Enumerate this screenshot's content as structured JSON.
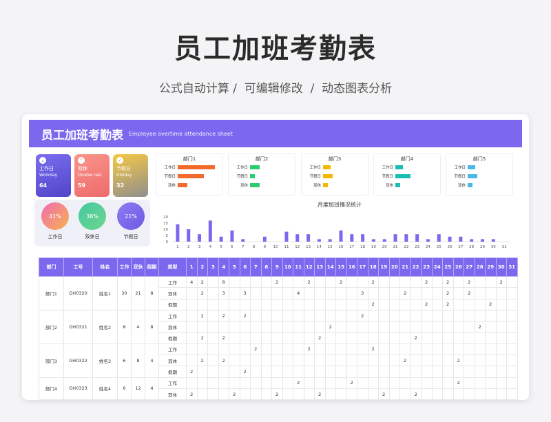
{
  "header": {
    "title": "员工加班考勤表",
    "subtitle": "公式自动计算 /  可编辑修改  /  动态图表分析"
  },
  "sheet": {
    "title": "员工加班考勤表",
    "title_en": "Employee overtime attendance sheet"
  },
  "cards": [
    {
      "label_cn": "工作日",
      "label_en": "Workday",
      "value": "64",
      "icon": "chevron-down-icon",
      "color": "#6a5be0"
    },
    {
      "label_cn": "双休",
      "label_en": "Double rest",
      "value": "59",
      "icon": "chevron-up-icon",
      "color": "#f47a6e"
    },
    {
      "label_cn": "节假日",
      "label_en": "Holiday",
      "value": "32",
      "icon": "check-icon",
      "color": "#f0b428"
    }
  ],
  "rings": [
    {
      "label": "工作日",
      "pct": "41%"
    },
    {
      "label": "双休日",
      "pct": "38%"
    },
    {
      "label": "节假日",
      "pct": "21%"
    }
  ],
  "dept_labels": [
    "工作日",
    "节假日",
    "双休"
  ],
  "dept_charts": [
    {
      "name": "部门1",
      "color": "#f26a2c",
      "values": [
        30,
        21,
        8
      ]
    },
    {
      "name": "部门2",
      "color": "#2ecc71",
      "values": [
        8,
        4,
        8
      ]
    },
    {
      "name": "部门3",
      "color": "#f5b800",
      "values": [
        6,
        8,
        4
      ]
    },
    {
      "name": "部门4",
      "color": "#18bfb0",
      "values": [
        6,
        12,
        4
      ]
    },
    {
      "name": "部门5",
      "color": "#4cb8e8",
      "values": [
        6,
        8,
        4
      ]
    }
  ],
  "chart_data": {
    "type": "bar",
    "title": "月度加班情况统计",
    "categories": [
      "1",
      "2",
      "3",
      "4",
      "5",
      "6",
      "7",
      "8",
      "9",
      "10",
      "11",
      "12",
      "13",
      "14",
      "15",
      "16",
      "17",
      "18",
      "19",
      "20",
      "21",
      "22",
      "23",
      "24",
      "25",
      "26",
      "27",
      "28",
      "29",
      "30",
      "31"
    ],
    "values": [
      14,
      10,
      6,
      17,
      4,
      9,
      2,
      0,
      4,
      0,
      8,
      6,
      6,
      2,
      2,
      9,
      6,
      6,
      2,
      2,
      6,
      6,
      6,
      2,
      6,
      4,
      4,
      2,
      2,
      2,
      0
    ],
    "yticks": [
      "0",
      "5",
      "10",
      "15",
      "20"
    ],
    "ylim": [
      0,
      20
    ],
    "color": "#7b68ee"
  },
  "table": {
    "headers": [
      "部门",
      "工号",
      "姓名",
      "工作",
      "双休",
      "假期",
      "类型"
    ],
    "days": [
      "1",
      "2",
      "3",
      "4",
      "5",
      "6",
      "7",
      "8",
      "9",
      "10",
      "11",
      "12",
      "13",
      "14",
      "15",
      "16",
      "17",
      "18",
      "19",
      "20",
      "21",
      "22",
      "23",
      "24",
      "25",
      "26",
      "27",
      "28",
      "29",
      "30",
      "31"
    ],
    "groups": [
      {
        "dept": "部门1",
        "id": "GH0320",
        "name": "姓名1",
        "work": "30",
        "rest": "21",
        "holiday": "8",
        "rows": [
          {
            "type": "工作",
            "cells": [
              "4",
              "2",
              "",
              "8",
              "",
              "",
              "",
              "",
              "2",
              "",
              "",
              "2",
              "",
              "",
              "2",
              "",
              "",
              "2",
              "",
              "",
              "",
              "",
              "2",
              "",
              "2",
              "",
              "2",
              "",
              "",
              "2",
              ""
            ]
          },
          {
            "type": "双休",
            "cells": [
              "",
              "2",
              "",
              "3",
              "",
              "3",
              "",
              "",
              "",
              "",
              "4",
              "",
              "",
              "",
              "",
              "",
              "3",
              "",
              "",
              "",
              "2",
              "",
              "",
              "",
              "2",
              "",
              "2",
              "",
              "",
              "",
              ""
            ]
          },
          {
            "type": "假期",
            "cells": [
              "",
              "",
              "",
              "",
              "",
              "",
              "",
              "",
              "",
              "",
              "",
              "",
              "",
              "",
              "",
              "",
              "",
              "2",
              "",
              "",
              "",
              "",
              "2",
              "",
              "2",
              "",
              "",
              "",
              "2",
              "",
              ""
            ]
          }
        ]
      },
      {
        "dept": "部门2",
        "id": "GH0321",
        "name": "姓名2",
        "work": "8",
        "rest": "4",
        "holiday": "8",
        "rows": [
          {
            "type": "工作",
            "cells": [
              "",
              "2",
              "",
              "2",
              "",
              "2",
              "",
              "",
              "",
              "",
              "",
              "",
              "",
              "",
              "",
              "",
              "2",
              "",
              "",
              "",
              "",
              "",
              "",
              "",
              "",
              "",
              "",
              "",
              "",
              "",
              ""
            ]
          },
          {
            "type": "双休",
            "cells": [
              "",
              "",
              "",
              "",
              "",
              "",
              "",
              "",
              "",
              "",
              "",
              "",
              "",
              "2",
              "",
              "",
              "",
              "",
              "",
              "",
              "",
              "",
              "",
              "",
              "",
              "",
              "",
              "2",
              "",
              "",
              ""
            ]
          },
          {
            "type": "假期",
            "cells": [
              "",
              "2",
              "",
              "2",
              "",
              "",
              "",
              "",
              "",
              "",
              "",
              "",
              "2",
              "",
              "",
              "",
              "",
              "",
              "",
              "",
              "",
              "2",
              "",
              "",
              "",
              "",
              "",
              "",
              "",
              "",
              ""
            ]
          }
        ]
      },
      {
        "dept": "部门3",
        "id": "GH0322",
        "name": "姓名3",
        "work": "6",
        "rest": "8",
        "holiday": "4",
        "rows": [
          {
            "type": "工作",
            "cells": [
              "",
              "",
              "",
              "",
              "",
              "",
              "2",
              "",
              "",
              "",
              "",
              "2",
              "",
              "",
              "",
              "",
              "",
              "2",
              "",
              "",
              "",
              "",
              "",
              "",
              "",
              "",
              "",
              "",
              "",
              "",
              ""
            ]
          },
          {
            "type": "双休",
            "cells": [
              "",
              "2",
              "",
              "2",
              "",
              "",
              "",
              "",
              "",
              "",
              "",
              "",
              "",
              "",
              "",
              "",
              "",
              "",
              "",
              "",
              "2",
              "",
              "",
              "",
              "",
              "2",
              "",
              "",
              "",
              "",
              ""
            ]
          },
          {
            "type": "假期",
            "cells": [
              "2",
              "",
              "",
              "",
              "",
              "2",
              "",
              "",
              "",
              "",
              "",
              "",
              "",
              "",
              "",
              "",
              "",
              "",
              "",
              "",
              "",
              "",
              "",
              "",
              "",
              "",
              "",
              "",
              "",
              "",
              ""
            ]
          }
        ]
      },
      {
        "dept": "部门4",
        "id": "GH0323",
        "name": "姓名4",
        "work": "6",
        "rest": "12",
        "holiday": "4",
        "rows": [
          {
            "type": "工作",
            "cells": [
              "",
              "",
              "",
              "",
              "",
              "",
              "",
              "",
              "",
              "",
              "2",
              "",
              "",
              "",
              "",
              "2",
              "",
              "",
              "",
              "",
              "",
              "",
              "",
              "",
              "",
              "2",
              "",
              "",
              "",
              "",
              ""
            ]
          },
          {
            "type": "双休",
            "cells": [
              "2",
              "",
              "",
              "",
              "2",
              "",
              "",
              "",
              "2",
              "",
              "",
              "",
              "2",
              "",
              "",
              "",
              "",
              "",
              "2",
              "",
              "",
              "2",
              "",
              "",
              "",
              "",
              "",
              "",
              "",
              "",
              ""
            ]
          }
        ]
      }
    ]
  }
}
